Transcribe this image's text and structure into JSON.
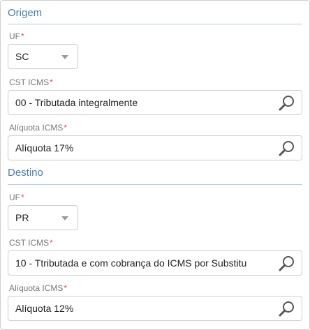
{
  "origem": {
    "title": "Origem",
    "uf": {
      "label": "UF",
      "required_mark": "*",
      "value": "SC"
    },
    "cst_icms": {
      "label": "CST ICMS",
      "required_mark": "*",
      "value": "00 - Tributada integralmente"
    },
    "aliquota_icms": {
      "label": "Alíquota ICMS",
      "required_mark": "*",
      "value": "Alíquota 17%"
    }
  },
  "destino": {
    "title": "Destino",
    "uf": {
      "label": "UF",
      "required_mark": "*",
      "value": "PR"
    },
    "cst_icms": {
      "label": "CST ICMS",
      "required_mark": "*",
      "value": "10 - Ttributada e com cobrança do ICMS por Substitu"
    },
    "aliquota_icms": {
      "label": "Alíquota ICMS",
      "required_mark": "*",
      "value": "Alíquota 12%"
    }
  },
  "colors": {
    "section_title": "#4a7fae",
    "required_mark": "#d9534f",
    "border": "#cfcfcf"
  },
  "icons": {
    "dropdown": "chevron-down-icon",
    "lookup": "search-icon"
  }
}
